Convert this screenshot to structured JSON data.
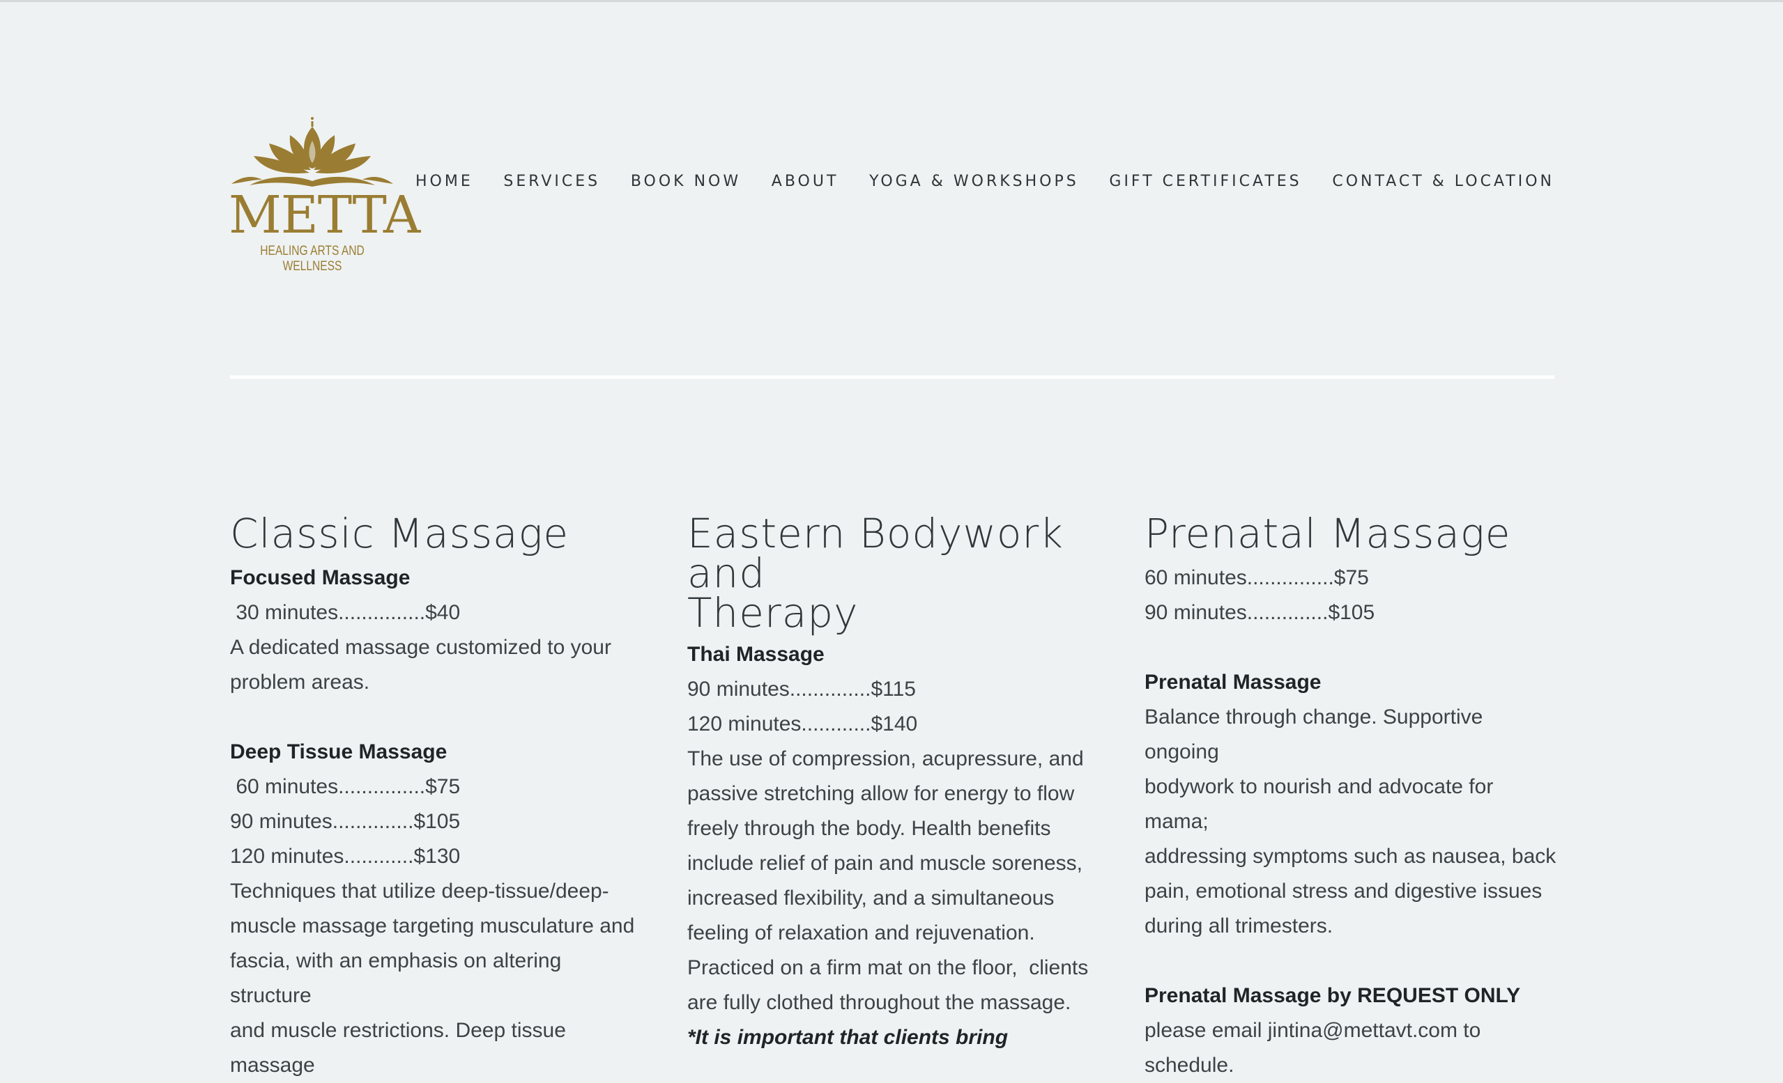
{
  "logo": {
    "wordmark": "METTA",
    "tagline": "HEALING ARTS AND WELLNESS"
  },
  "nav": [
    "HOME",
    "SERVICES",
    "BOOK NOW",
    "ABOUT",
    "YOGA & WORKSHOPS",
    "GIFT CERTIFICATES",
    "CONTACT & LOCATION"
  ],
  "columns": {
    "classic": {
      "title": "Classic Massage",
      "focused_title": "Focused Massage",
      "focused_price": " 30 minutes...............$40",
      "focused_desc_1": "A dedicated massage customized to your",
      "focused_desc_2": "problem areas.",
      "deep_title": "Deep Tissue Massage",
      "deep_p1": " 60 minutes...............$75",
      "deep_p2": "90 minutes..............$105",
      "deep_p3": "120 minutes............$130",
      "deep_d1": "Techniques that utilize deep-tissue/deep-",
      "deep_d2": "muscle massage targeting musculature and",
      "deep_d3": "fascia, with an emphasis on altering structure",
      "deep_d4": "and muscle restrictions. Deep tissue massage"
    },
    "eastern": {
      "title_1": "Eastern Bodywork and",
      "title_2": "Therapy",
      "thai_title": "Thai Massage",
      "thai_p1": "90 minutes..............$115",
      "thai_p2": "120 minutes............$140",
      "d1": "The use of compression, acupressure, and",
      "d2": "passive stretching allow for energy to flow",
      "d3": "freely through the body. Health benefits",
      "d4": "include relief of pain and muscle soreness,",
      "d5": "increased flexibility, and a simultaneous",
      "d6": "feeling of relaxation and rejuvenation.",
      "d7": "Practiced on a firm mat on the floor,  clients",
      "d8": "are fully clothed throughout the massage.",
      "d9": "*It is important that clients bring"
    },
    "prenatal": {
      "title": "Prenatal Massage",
      "p1": "60 minutes...............$75",
      "p2": "90 minutes..............$105",
      "sub1": "Prenatal Massage",
      "d1": "Balance through change. Supportive ongoing",
      "d2": "bodywork to nourish and advocate for mama;",
      "d3": "addressing symptoms such as nausea, back",
      "d4": "pain, emotional stress and digestive issues",
      "d5": "during all trimesters.",
      "sub2": "Prenatal Massage by REQUEST ONLY",
      "e1": "please email jintina@mettavt.com to",
      "e2": "schedule."
    }
  },
  "colors": {
    "gold": "#9a7d33",
    "background": "#eff2f2",
    "text": "#3c4345"
  }
}
